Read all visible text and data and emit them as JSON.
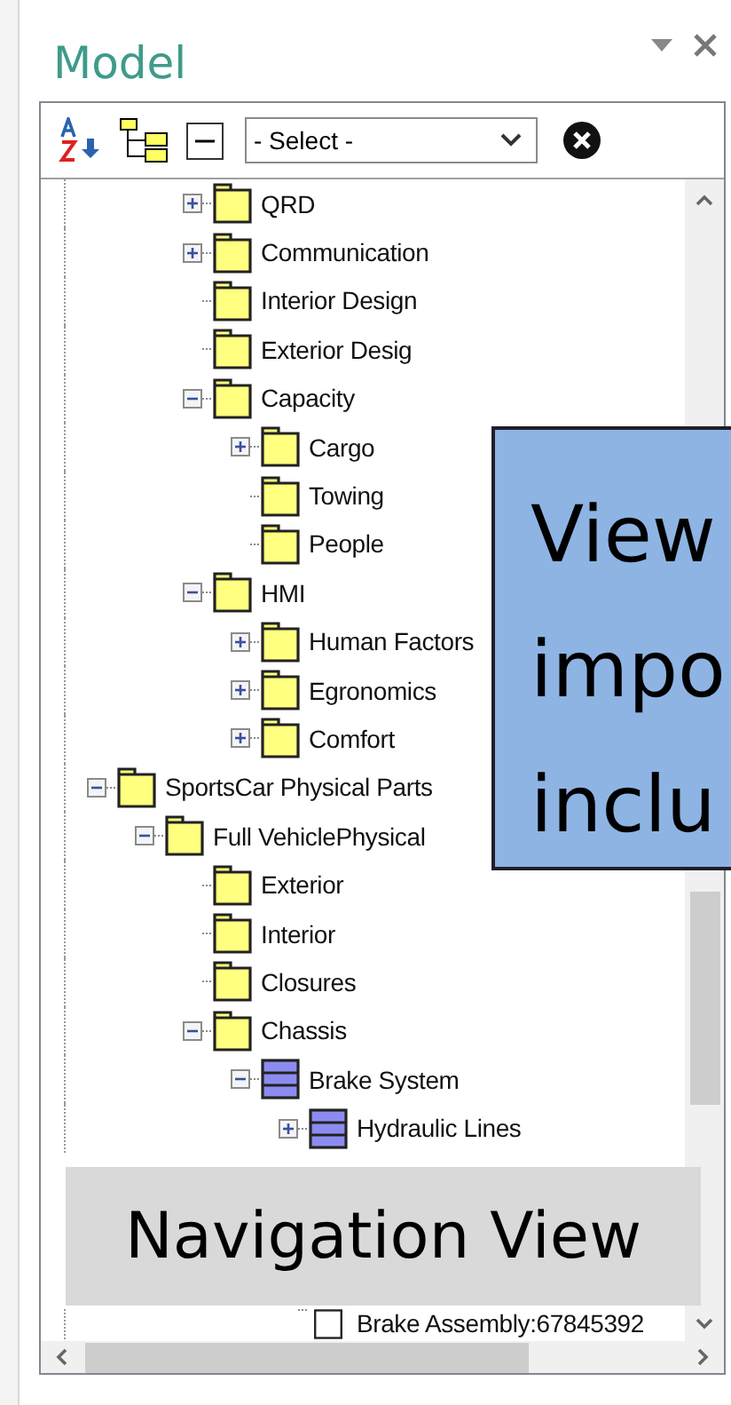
{
  "window": {
    "title": "Model"
  },
  "toolbar": {
    "select": {
      "value": "- Select -"
    }
  },
  "tree": {
    "scrolled_branch": [
      {
        "label": "QRD",
        "kind": "folder",
        "expanded": false
      },
      {
        "label": "Communication",
        "kind": "folder",
        "expanded": false
      },
      {
        "label": "Interior Design",
        "kind": "folder"
      },
      {
        "label": "Exterior Desig",
        "kind": "folder"
      },
      {
        "label": "Capacity",
        "kind": "folder",
        "expanded": true,
        "children": [
          {
            "label": "Cargo",
            "kind": "folder",
            "expanded": false
          },
          {
            "label": "Towing",
            "kind": "folder"
          },
          {
            "label": "People",
            "kind": "folder"
          }
        ]
      },
      {
        "label": "HMI",
        "kind": "folder",
        "expanded": true,
        "children": [
          {
            "label": "Human Factors",
            "kind": "folder",
            "expanded": false
          },
          {
            "label": "Egronomics",
            "kind": "folder",
            "expanded": false
          },
          {
            "label": "Comfort",
            "kind": "folder",
            "expanded": false
          }
        ]
      }
    ],
    "items": [
      {
        "label": "SportsCar Physical Parts",
        "kind": "folder",
        "expanded": true,
        "children": [
          {
            "label": "Full VehiclePhysical",
            "kind": "folder",
            "expanded": true,
            "children": [
              {
                "label": "Exterior",
                "kind": "folder"
              },
              {
                "label": "Interior",
                "kind": "folder"
              },
              {
                "label": "Closures",
                "kind": "folder"
              },
              {
                "label": "Chassis",
                "kind": "folder",
                "expanded": true,
                "children": [
                  {
                    "label": "Brake System",
                    "kind": "block",
                    "expanded": true,
                    "children": [
                      {
                        "label": "Hydraulic Lines",
                        "kind": "block",
                        "expanded": false
                      }
                    ]
                  }
                ]
              }
            ]
          }
        ]
      }
    ],
    "below_overlay": [
      {
        "label": "Brake Assembly:67845392",
        "kind": "part"
      }
    ]
  },
  "callout": {
    "text": "View impo inclu"
  },
  "caption": {
    "text": "Navigation View"
  }
}
